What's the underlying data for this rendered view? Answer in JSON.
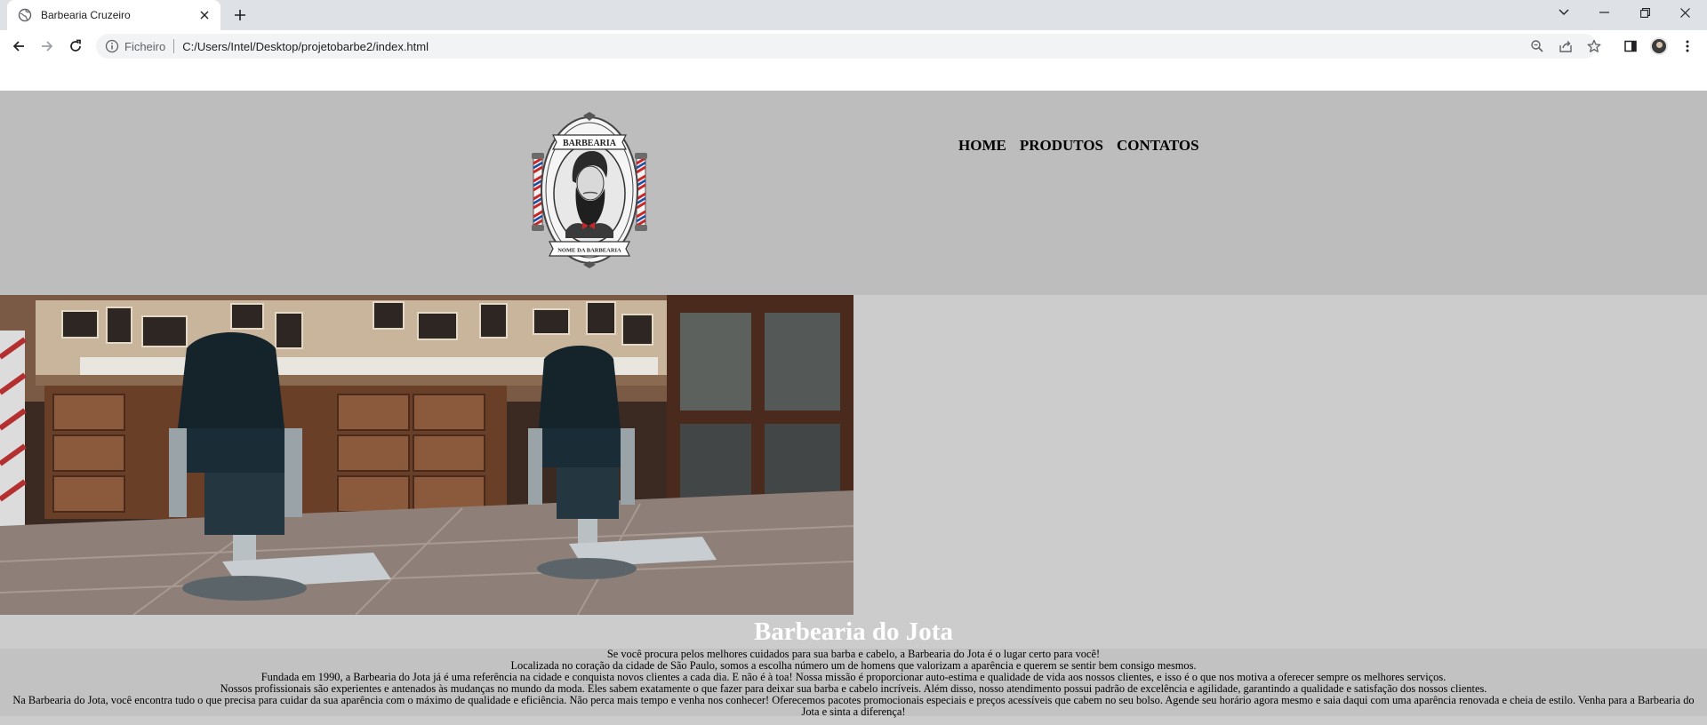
{
  "browser": {
    "tab_title": "Barbearia Cruzeiro",
    "scheme_label": "Ficheiro",
    "url": "C:/Users/Intel/Desktop/projetobarbe2/index.html"
  },
  "site": {
    "logo": {
      "top_text": "BARBEARIA",
      "bottom_text": "NOME DA BARBEARIA"
    },
    "nav": [
      "HOME",
      "PRODUTOS",
      "CONTATOS"
    ],
    "title": "Barbearia do Jota",
    "paragraphs": [
      "Se você procura pelos melhores cuidados para sua barba e cabelo, a Barbearia do Jota é o lugar certo para você!",
      "Localizada no coração da cidade de São Paulo, somos a escolha número um de homens que valorizam a aparência e querem se sentir bem consigo mesmos.",
      "Fundada em 1990, a Barbearia do Jota já é uma referência na cidade e conquista novos clientes a cada dia. E não é à toa! Nossa missão é proporcionar auto-estima e qualidade de vida aos nossos clientes, e isso é o que nos motiva a oferecer sempre os melhores serviços.",
      "Nossos profissionais são experientes e antenados às mudanças no mundo da moda. Eles sabem exatamente o que fazer para deixar sua barba e cabelo incríveis. Além disso, nosso atendimento possui padrão de excelência e agilidade, garantindo a qualidade e satisfação dos nossos clientes.",
      "Na Barbearia do Jota, você encontra tudo o que precisa para cuidar da sua aparência com o máximo de qualidade e eficiência. Não perca mais tempo e venha nos conhecer! Oferecemos pacotes promocionais especiais e preços acessíveis que cabem no seu bolso. Agende seu horário agora mesmo e saia daqui com uma aparência renovada e cheia de estilo. Venha para a Barbearia do Jota e sinta a diferença!"
    ]
  },
  "colors": {
    "header_bg": "#bdbdbd",
    "content_bg": "#cccccc",
    "title_color": "#ffffff"
  }
}
